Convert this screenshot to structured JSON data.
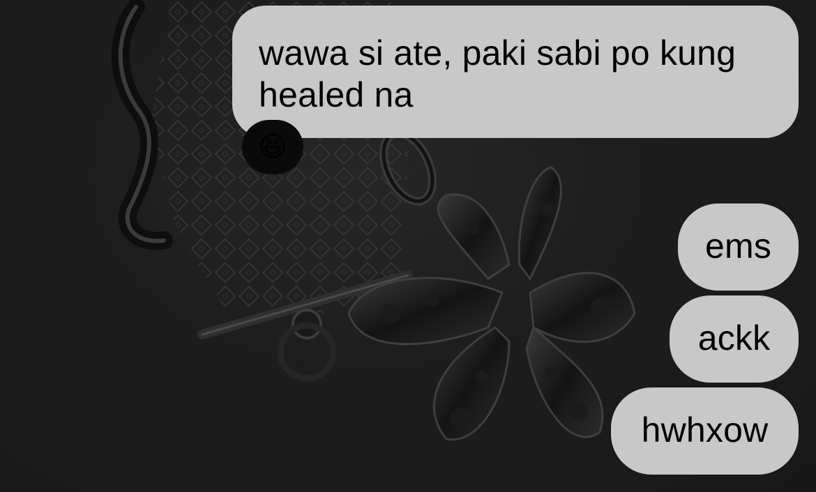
{
  "conversation": {
    "received_message": "wawa si ate, paki sabi po kung healed na",
    "tapback_reaction": "😆",
    "sent_messages": [
      "ems",
      "ackk",
      "hwhxow"
    ]
  },
  "colors": {
    "background": "#1b1b1b",
    "bubble": "#c8c8c8",
    "bubble_text": "#000000",
    "tapback": "#0a0a0a"
  }
}
